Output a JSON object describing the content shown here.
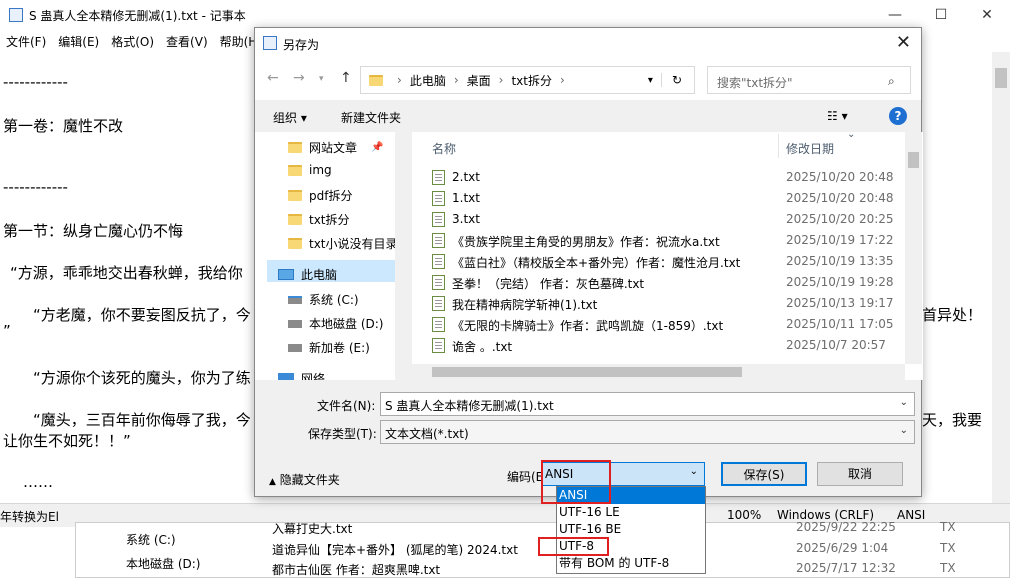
{
  "notepad": {
    "title": "S 蛊真人全本精修无删减(1).txt - 记事本",
    "menu": [
      "文件(F)",
      "编辑(E)",
      "格式(O)",
      "查看(V)",
      "帮助(H)"
    ],
    "lines": [
      "------------",
      "第一卷：魔性不改",
      "------------",
      "第一节：纵身亡魔心仍不悔",
      "“方源，乖乖地交出春秋蝉，我给你",
      "“方老魔，你不要妄图反抗了，今",
      "”",
      "“方源你个该死的魔头，你为了练",
      "“魔头，三百年前你侮辱了我，今",
      "让你生不如死！！”",
      "……",
      "首异处！",
      "天，我要"
    ],
    "status": {
      "partial_left": "年转换为El",
      "zoom": "100%",
      "eol": "Windows (CRLF)",
      "encoding": "ANSI"
    }
  },
  "background": {
    "rows": [
      {
        "name": "入幕打史大.txt",
        "date": "2025/9/22 22:25",
        "type": "TX"
      },
      {
        "name": "道诡异仙【完本+番外】 (狐尾的笔) 2024.txt",
        "date": "2025/6/29 1:04",
        "type": "TX"
      },
      {
        "name": "都市古仙医 作者：超爽黑啤.txt",
        "date": "2025/7/17 12:32",
        "type": "TX"
      }
    ],
    "tree": [
      "系统 (C:)",
      "本地磁盘 (D:)"
    ]
  },
  "dialog": {
    "title": "另存为",
    "breadcrumb": [
      "此电脑",
      "桌面",
      "txt拆分"
    ],
    "search_placeholder": "搜索\"txt拆分\"",
    "organize": "组织 ▾",
    "new_folder": "新建文件夹",
    "tree": [
      {
        "label": "网站文章",
        "type": "folder"
      },
      {
        "label": "img",
        "type": "folder"
      },
      {
        "label": "pdf拆分",
        "type": "folder"
      },
      {
        "label": "txt拆分",
        "type": "folder"
      },
      {
        "label": "txt小说没有目录",
        "type": "folder"
      },
      {
        "label": "此电脑",
        "type": "pc"
      },
      {
        "label": "系统 (C:)",
        "type": "drive"
      },
      {
        "label": "本地磁盘 (D:)",
        "type": "drive"
      },
      {
        "label": "新加卷 (E:)",
        "type": "drive"
      },
      {
        "label": "网络",
        "type": "network"
      }
    ],
    "columns": {
      "name": "名称",
      "date": "修改日期"
    },
    "files": [
      {
        "name": "2.txt",
        "date": "2025/10/20 20:48"
      },
      {
        "name": "1.txt",
        "date": "2025/10/20 20:48"
      },
      {
        "name": "3.txt",
        "date": "2025/10/20 20:25"
      },
      {
        "name": "《贵族学院里主角受的男朋友》作者：祝流水a.txt",
        "date": "2025/10/19 17:22"
      },
      {
        "name": "《蓝白社》（精校版全本+番外完）作者：魔性沧月.txt",
        "date": "2025/10/19 13:35"
      },
      {
        "name": "圣拳！（完结） 作者：灰色墓碑.txt",
        "date": "2025/10/19 19:28"
      },
      {
        "name": "我在精神病院学斩神(1).txt",
        "date": "2025/10/13 19:17"
      },
      {
        "name": "《无限的卡牌骑士》作者：武鸣凯旋（1-859）.txt",
        "date": "2025/10/11 17:05"
      },
      {
        "name": "诡舍 。.txt",
        "date": "2025/10/7 20:57"
      }
    ],
    "filename_label": "文件名(N):",
    "filename": "S 蛊真人全本精修无删减(1).txt",
    "filetype_label": "保存类型(T):",
    "filetype": "文本文档(*.txt)",
    "hide_folders": "隐藏文件夹",
    "encoding_label": "编码(E):",
    "encoding_value": "ANSI",
    "encoding_options": [
      "ANSI",
      "UTF-16 LE",
      "UTF-16 BE",
      "UTF-8",
      "带有 BOM 的 UTF-8"
    ],
    "save": "保存(S)",
    "cancel": "取消"
  },
  "colors": {
    "accent": "#0078d7",
    "highlight": "#e02020",
    "selection": "#cce8ff"
  }
}
